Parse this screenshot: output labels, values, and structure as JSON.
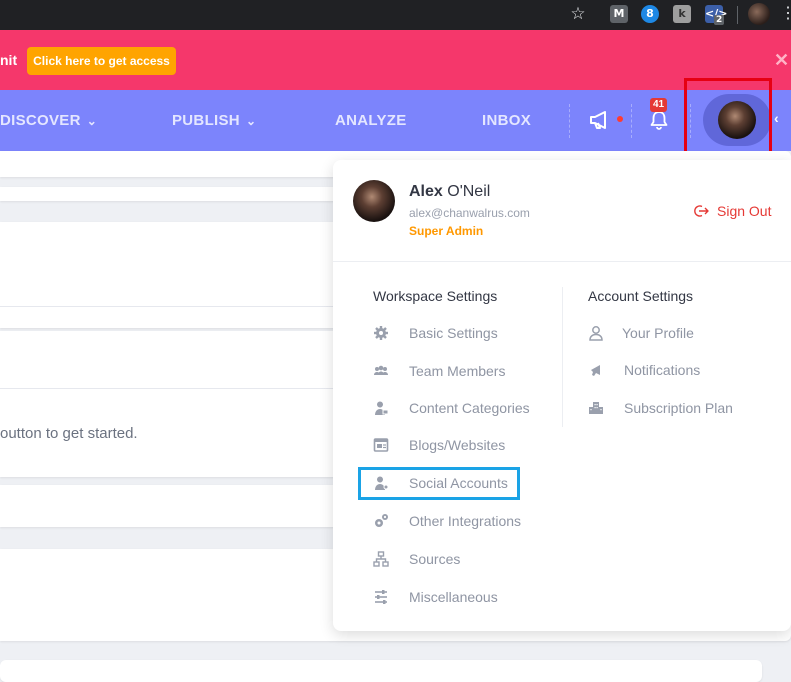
{
  "banner": {
    "text_fragment": "nit",
    "cta_label": "Click here to get access",
    "close_glyph": "✕"
  },
  "nav": {
    "items": [
      {
        "label": "DISCOVER",
        "has_dropdown": true
      },
      {
        "label": "PUBLISH",
        "has_dropdown": true
      },
      {
        "label": "ANALYZE",
        "has_dropdown": false
      },
      {
        "label": "INBOX",
        "has_dropdown": false
      }
    ],
    "notification_count": "41",
    "icons": [
      "megaphone-icon",
      "bell-icon",
      "avatar"
    ]
  },
  "background": {
    "hint_text": "outton to get started."
  },
  "profile_menu": {
    "first_name": "Alex",
    "last_name": " O'Neil",
    "email": "alex@chanwalrus.com",
    "role": "Super Admin",
    "sign_out_label": "Sign Out",
    "workspace": {
      "title": "Workspace Settings",
      "items": [
        {
          "label": "Basic Settings",
          "icon": "gear-icon"
        },
        {
          "label": "Team Members",
          "icon": "team-icon"
        },
        {
          "label": "Content Categories",
          "icon": "user-tag-icon"
        },
        {
          "label": "Blogs/Websites",
          "icon": "website-icon"
        },
        {
          "label": "Social Accounts",
          "icon": "user-share-icon"
        },
        {
          "label": "Other Integrations",
          "icon": "gears-icon"
        },
        {
          "label": "Sources",
          "icon": "sitemap-icon"
        },
        {
          "label": "Miscellaneous",
          "icon": "sliders-icon"
        }
      ]
    },
    "account": {
      "title": "Account Settings",
      "items": [
        {
          "label": "Your Profile",
          "icon": "user-outline-icon"
        },
        {
          "label": "Notifications",
          "icon": "megaphone-icon"
        },
        {
          "label": "Subscription Plan",
          "icon": "building-icon"
        }
      ]
    }
  },
  "colors": {
    "banner_bg": "#f5376b",
    "cta_bg": "#ffa400",
    "nav_bg": "#7c84fc",
    "sign_out": "#e53935",
    "role": "#ff9800",
    "highlight_red": "#e60012",
    "highlight_blue": "#1aa3e6"
  }
}
